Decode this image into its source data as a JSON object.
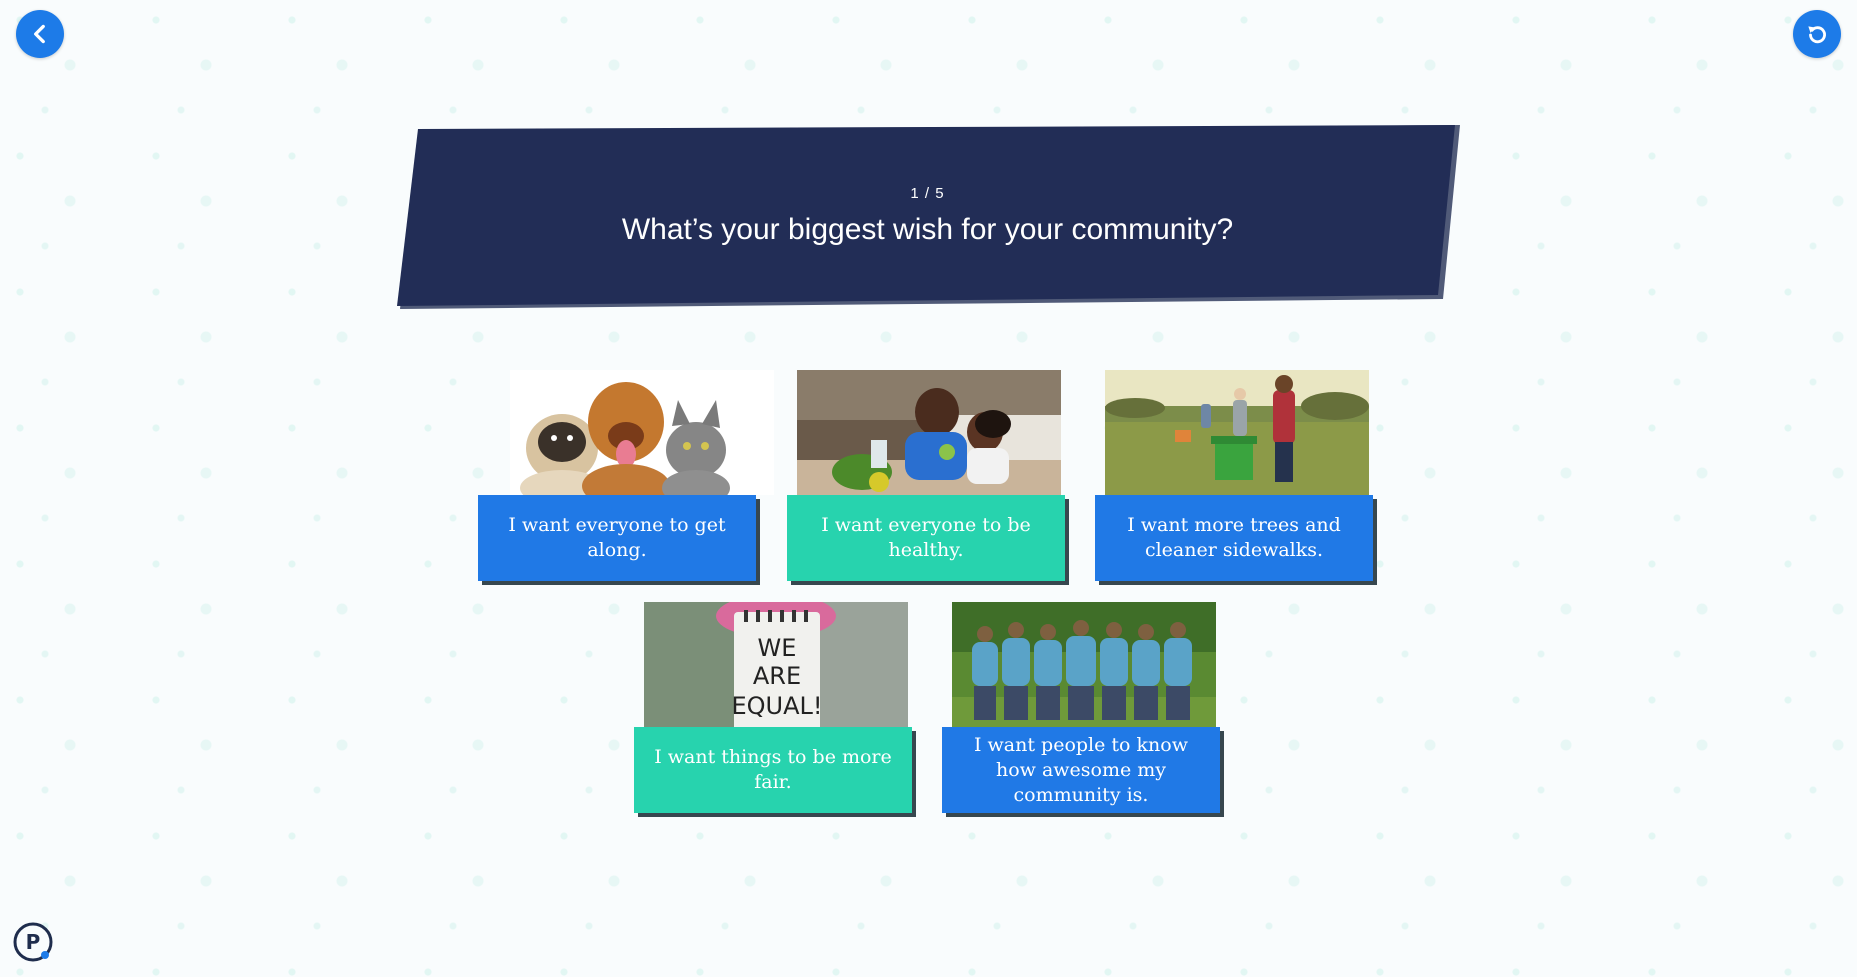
{
  "nav": {
    "back_icon": "chevron-left-icon",
    "reset_icon": "restart-icon"
  },
  "quiz": {
    "progress": "1 / 5",
    "question": "What’s your biggest wish for your community?"
  },
  "answers": [
    {
      "label": "I want everyone to get along.",
      "color": "#2079e6",
      "image": "pets-dog-puppy-cat-photo"
    },
    {
      "label": "I want everyone to be healthy.",
      "color": "#27d3ae",
      "image": "father-child-healthy-food-photo"
    },
    {
      "label": "I want more trees and cleaner sidewalks.",
      "color": "#2079e6",
      "image": "kids-recycling-park-photo"
    },
    {
      "label": "I want things to be more fair.",
      "color": "#27d3ae",
      "image": "we-are-equal-sign-photo"
    },
    {
      "label": "I want people to know how awesome my community is.",
      "color": "#2079e6",
      "image": "volunteers-arm-in-arm-photo"
    }
  ],
  "colors": {
    "banner": "#222d56",
    "accent_blue": "#1d7be8",
    "accent_teal": "#27d3ae"
  }
}
